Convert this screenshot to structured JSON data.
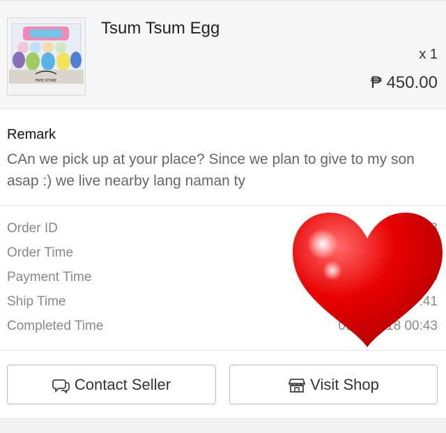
{
  "product": {
    "name": "Tsum Tsum Egg",
    "quantity": "x 1",
    "price": "₱ 450.00",
    "thumbnail_caption": "FAYE STORE"
  },
  "remark": {
    "title": "Remark",
    "text": "CAn we pick up at your place? Since we plan to give to my son asap :) we live nearby lang naman ty"
  },
  "order_info": {
    "rows": [
      {
        "label": "Order ID",
        "value": "02                    3"
      },
      {
        "label": "Order Time",
        "value": ""
      },
      {
        "label": "Payment Time",
        "value": "0"
      },
      {
        "label": "Ship Time",
        "value": ":41"
      },
      {
        "label": "Completed Time",
        "value": "01/0      18 00:43"
      }
    ]
  },
  "buttons": {
    "contact_label": "Contact Seller",
    "visit_label": "Visit Shop"
  },
  "icons": {
    "contact": "chat-bubbles-icon",
    "visit": "shop-icon",
    "overlay": "heart-icon"
  },
  "colors": {
    "heart": "#e00000",
    "border": "#bdbdbd"
  }
}
